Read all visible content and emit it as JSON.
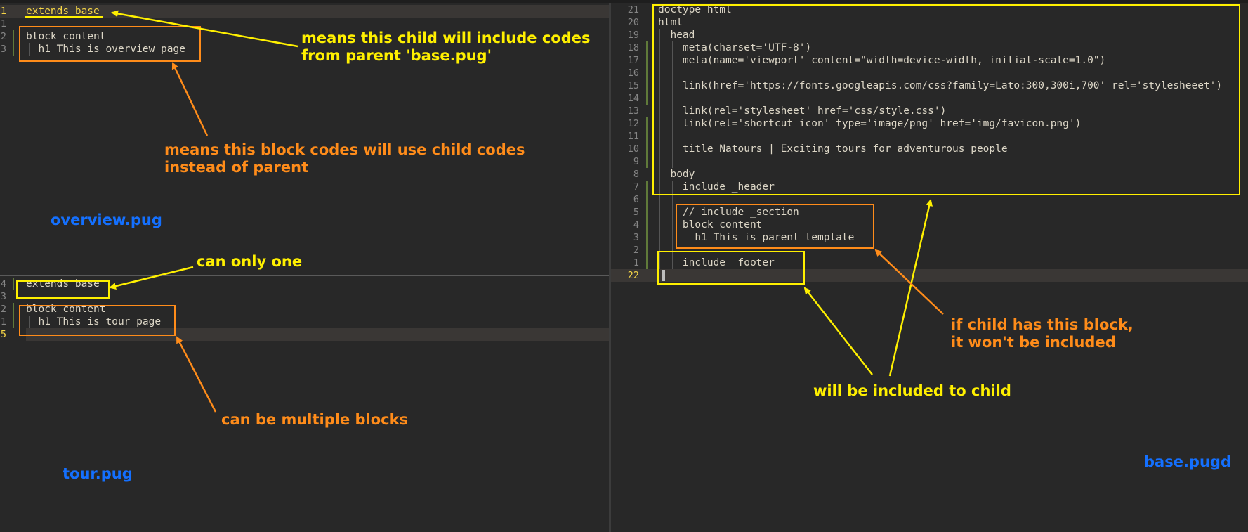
{
  "colors": {
    "background": "#282828",
    "yellow_annotation": "#fff000",
    "orange_annotation": "#ff8c1a",
    "blue_filename_label": "#1470ff",
    "active_line_number": "#f5d547"
  },
  "overview_pane": {
    "line_numbers": [
      "1",
      "1",
      "2",
      "3"
    ],
    "lines": [
      "extends base",
      "",
      "block content",
      "  h1 This is overview page"
    ],
    "file_label": "overview.pug"
  },
  "tour_pane": {
    "line_numbers": [
      "4",
      "3",
      "2",
      "1",
      "5"
    ],
    "lines": [
      "extends base",
      "",
      "block content",
      "  h1 This is tour page",
      ""
    ],
    "file_label": "tour.pug"
  },
  "base_pane": {
    "line_numbers": [
      "21",
      "20",
      "19",
      "18",
      "17",
      "16",
      "15",
      "14",
      "13",
      "12",
      "11",
      "10",
      "9",
      "8",
      "7",
      "6",
      "5",
      "4",
      "3",
      "2",
      "1",
      "22"
    ],
    "lines": [
      "doctype html",
      "html",
      "  head",
      "    meta(charset='UTF-8')",
      "    meta(name='viewport' content=\"width=device-width, initial-scale=1.0\")",
      "",
      "    link(href='https://fonts.googleapis.com/css?family=Lato:300,300i,700' rel='stylesheeet')",
      "",
      "    link(rel='stylesheet' href='css/style.css')",
      "    link(rel='shortcut icon' type='image/png' href='img/favicon.png')",
      "",
      "    title Natours | Exciting tours for adventurous people",
      "",
      "  body",
      "    include _header",
      "",
      "    // include _section",
      "    block content",
      "      h1 This is parent template",
      "",
      "    include _footer",
      ""
    ],
    "file_label": "base.pugd"
  },
  "annotations": {
    "extends_note": "means this child will include codes\nfrom parent 'base.pug'",
    "block_note": "means this block codes will use child codes\ninstead of parent",
    "can_only_one": "can only one",
    "multiple_blocks": "can be multiple blocks",
    "if_child_has_block": "if child has this block,\nit won't be included",
    "included_to_child": "will be included to child"
  }
}
